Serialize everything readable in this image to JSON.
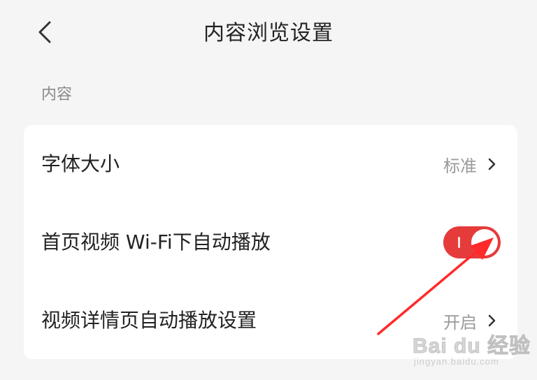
{
  "header": {
    "title": "内容浏览设置",
    "back_icon": "chevron-left-icon"
  },
  "section": {
    "label": "内容"
  },
  "rows": [
    {
      "label": "字体大小",
      "value": "标准",
      "icon": "chevron-right-icon"
    },
    {
      "label": "首页视频 Wi-Fi下自动播放",
      "toggle_on": true,
      "toggle_color": "#e53b3b"
    },
    {
      "label": "视频详情页自动播放设置",
      "value": "开启",
      "icon": "chevron-right-icon"
    }
  ],
  "annotation": {
    "arrow_color": "#ff2a2a",
    "icon": "red-arrow-annotation"
  },
  "watermark": {
    "logo": "Bai du 经验",
    "url": "jingyan.baidu.com"
  }
}
